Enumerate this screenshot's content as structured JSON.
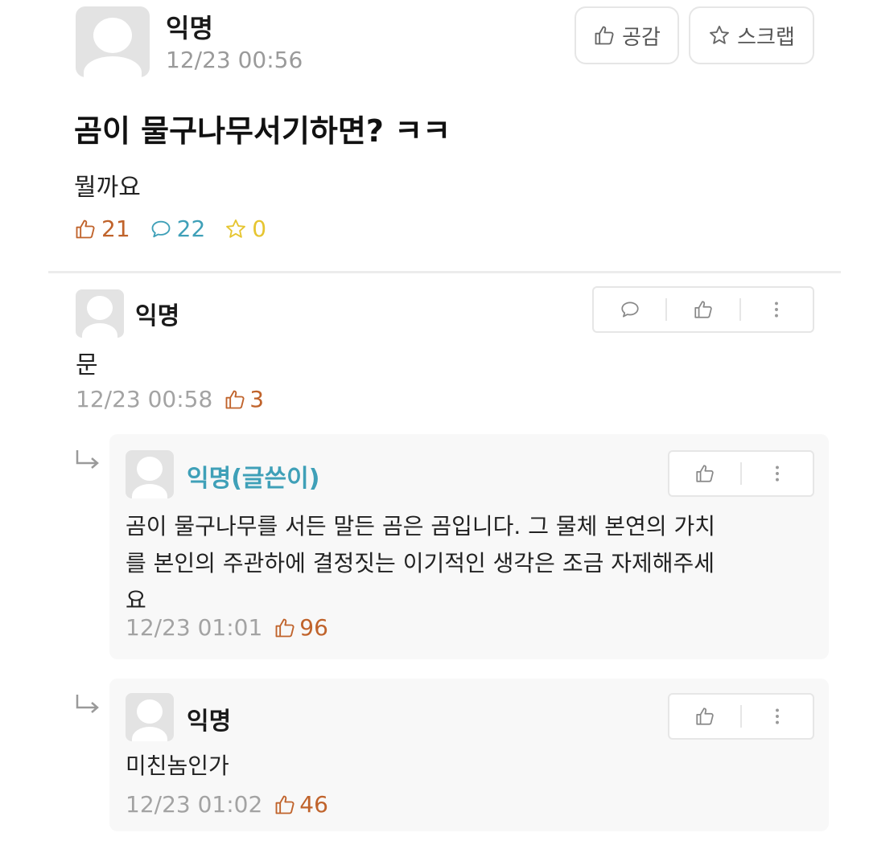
{
  "post": {
    "author": "익명",
    "timestamp": "12/23 00:56",
    "buttons": {
      "like": "공감",
      "scrap": "스크랩"
    },
    "title": "곰이 물구나무서기하면? ㅋㅋ",
    "body": "뭘까요",
    "stats": {
      "likes": "21",
      "comments": "22",
      "scraps": "0"
    }
  },
  "comments": [
    {
      "author": "익명",
      "body": "문",
      "timestamp": "12/23 00:58",
      "likes": "3"
    }
  ],
  "replies": [
    {
      "author": "익명(글쓴이)",
      "body_lines": [
        "곰이 물구나무를 서든 말든 곰은 곰입니다. 그 물체 본연의 가치",
        "를 본인의 주관하에 결정짓는 이기적인 생각은 조금 자제해주세",
        "요"
      ],
      "timestamp": "12/23 01:01",
      "likes": "96"
    },
    {
      "author": "익명",
      "body_lines": [
        "미친놈인가"
      ],
      "timestamp": "12/23 01:02",
      "likes": "46"
    }
  ],
  "colors": {
    "like": "#c0632b",
    "comment": "#3fa0b8",
    "scrap": "#e6c530",
    "op_name": "#3fa0b8"
  }
}
